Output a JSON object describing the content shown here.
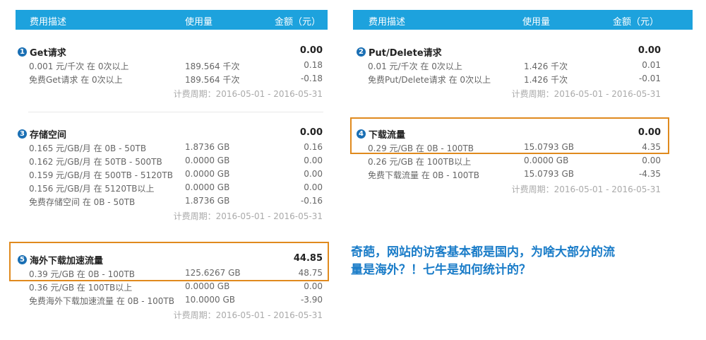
{
  "header": {
    "left": {
      "desc": "费用描述",
      "usage": "使用量",
      "amount": "金额（元）"
    },
    "right": {
      "desc": "费用描述",
      "usage": "使用量",
      "amount": "金额（元）"
    }
  },
  "sections": [
    {
      "num": "1",
      "title": "Get请求",
      "total": "0.00",
      "rows": [
        {
          "desc": "0.001 元/千次 在 0次以上",
          "usage": "189.564 千次",
          "amount": "0.18"
        },
        {
          "desc": "免费Get请求 在 0次以上",
          "usage": "189.564 千次",
          "amount": "-0.18"
        }
      ],
      "period": "计费周期：2016-05-01 - 2016-05-31"
    },
    {
      "num": "2",
      "title": "Put/Delete请求",
      "total": "0.00",
      "rows": [
        {
          "desc": "0.01 元/千次 在 0次以上",
          "usage": "1.426 千次",
          "amount": "0.01"
        },
        {
          "desc": "免费Put/Delete请求 在 0次以上",
          "usage": "1.426 千次",
          "amount": "-0.01"
        }
      ],
      "period": "计费周期：2016-05-01 - 2016-05-31"
    },
    {
      "num": "3",
      "title": "存储空间",
      "total": "0.00",
      "rows": [
        {
          "desc": "0.165 元/GB/月 在 0B - 50TB",
          "usage": "1.8736 GB",
          "amount": "0.16"
        },
        {
          "desc": "0.162 元/GB/月 在 50TB - 500TB",
          "usage": "0.0000 GB",
          "amount": "0.00"
        },
        {
          "desc": "0.159 元/GB/月 在 500TB - 5120TB",
          "usage": "0.0000 GB",
          "amount": "0.00"
        },
        {
          "desc": "0.156 元/GB/月 在 5120TB以上",
          "usage": "0.0000 GB",
          "amount": "0.00"
        },
        {
          "desc": "免费存储空间 在 0B - 50TB",
          "usage": "1.8736 GB",
          "amount": "-0.16"
        }
      ],
      "period": "计费周期：2016-05-01 - 2016-05-31"
    },
    {
      "num": "4",
      "title": "下载流量",
      "total": "0.00",
      "rows": [
        {
          "desc": "0.29 元/GB 在 0B - 100TB",
          "usage": "15.0793 GB",
          "amount": "4.35"
        },
        {
          "desc": "0.26 元/GB 在 100TB以上",
          "usage": "0.0000 GB",
          "amount": "0.00"
        },
        {
          "desc": "免费下载流量 在 0B - 100TB",
          "usage": "15.0793 GB",
          "amount": "-4.35"
        }
      ],
      "period": "计费周期：2016-05-01 - 2016-05-31"
    },
    {
      "num": "5",
      "title": "海外下载加速流量",
      "total": "44.85",
      "rows": [
        {
          "desc": "0.39 元/GB 在 0B - 100TB",
          "usage": "125.6267 GB",
          "amount": "48.75"
        },
        {
          "desc": "0.36 元/GB 在 100TB以上",
          "usage": "0.0000 GB",
          "amount": "0.00"
        },
        {
          "desc": "免费海外下载加速流量 在 0B - 100TB",
          "usage": "10.0000 GB",
          "amount": "-3.90"
        }
      ],
      "period": "计费周期：2016-05-01 - 2016-05-31"
    }
  ],
  "annotation": {
    "line1": "奇葩，网站的访客基本都是国内，为啥大部分的流",
    "line2": "量是海外？！七牛是如何统计的？",
    "color": "#1a7cc8",
    "highlight_color": "#e08a1e"
  },
  "colors": {
    "header_bg": "#1da2dd",
    "icon_bg": "#1a6fb4"
  }
}
